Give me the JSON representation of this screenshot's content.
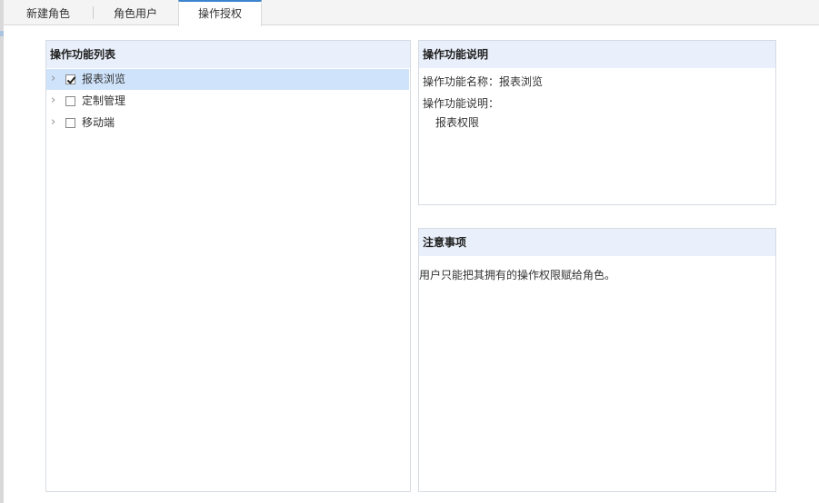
{
  "tabs": [
    {
      "label": "新建角色",
      "active": false
    },
    {
      "label": "角色用户",
      "active": false
    },
    {
      "label": "操作授权",
      "active": true
    }
  ],
  "function_list": {
    "title": "操作功能列表",
    "items": [
      {
        "label": "报表浏览",
        "checked": true,
        "selected": true
      },
      {
        "label": "定制管理",
        "checked": false,
        "selected": false
      },
      {
        "label": "移动端",
        "checked": false,
        "selected": false
      }
    ]
  },
  "function_desc": {
    "title": "操作功能说明",
    "name_label": "操作功能名称：",
    "name_value": "报表浏览",
    "desc_label": "操作功能说明：",
    "desc_value": "报表权限"
  },
  "notes": {
    "title": "注意事项",
    "text": "用户只能把其拥有的操作权限赋给角色。"
  },
  "colors": {
    "accent": "#3d84cf",
    "panel_header": "#e9f0fb",
    "selected_row": "#cfe3fb"
  }
}
